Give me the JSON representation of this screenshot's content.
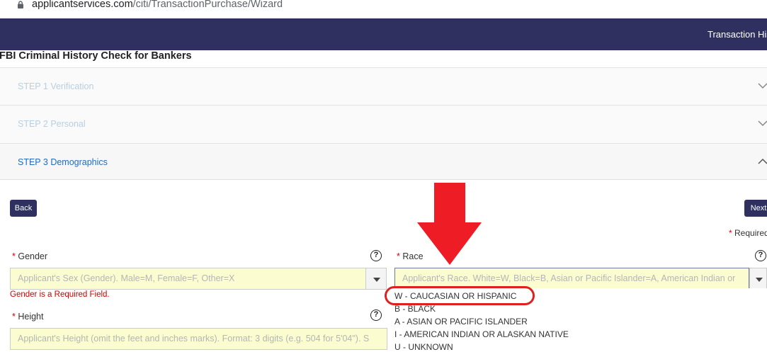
{
  "browser": {
    "url_domain": "applicantservices.com",
    "url_path": "/citi/TransactionPurchase/Wizard"
  },
  "navbar": {
    "link": "Transaction His"
  },
  "page": {
    "title": "FBI Criminal History Check for Bankers"
  },
  "steps": [
    {
      "label": "STEP 1 Verification",
      "state": "collapsed"
    },
    {
      "label": "STEP 2 Personal",
      "state": "collapsed"
    },
    {
      "label": "STEP 3 Demographics",
      "state": "expanded"
    }
  ],
  "buttons": {
    "back": "Back",
    "next": "Next"
  },
  "required_note": {
    "star": "*",
    "text": " Required"
  },
  "form": {
    "gender": {
      "star": "*",
      "label": " Gender",
      "placeholder": "Applicant's Sex (Gender). Male=M, Female=F, Other=X",
      "error": "Gender is a Required Field."
    },
    "race": {
      "star": "*",
      "label": " Race",
      "placeholder": "Applicant's Race. White=W, Black=B, Asian or Pacific Islander=A, American Indian or"
    },
    "height": {
      "star": "*",
      "label": " Height",
      "placeholder": "Applicant's Height (omit the feet and inches marks). Format: 3 digits (e.g. 504 for 5'04\"). S"
    }
  },
  "race_options": [
    "W - CAUCASIAN OR HISPANIC",
    "B - BLACK",
    "A - ASIAN OR PACIFIC ISLANDER",
    "I - AMERICAN INDIAN OR ALASKAN NATIVE",
    "U - UNKNOWN"
  ],
  "help_glyph": "?",
  "colors": {
    "navbar": "#2f3060",
    "input_bg": "#fbfdd0",
    "error": "#d40000",
    "annotation": "#e02020",
    "link": "#1f6bbf"
  }
}
